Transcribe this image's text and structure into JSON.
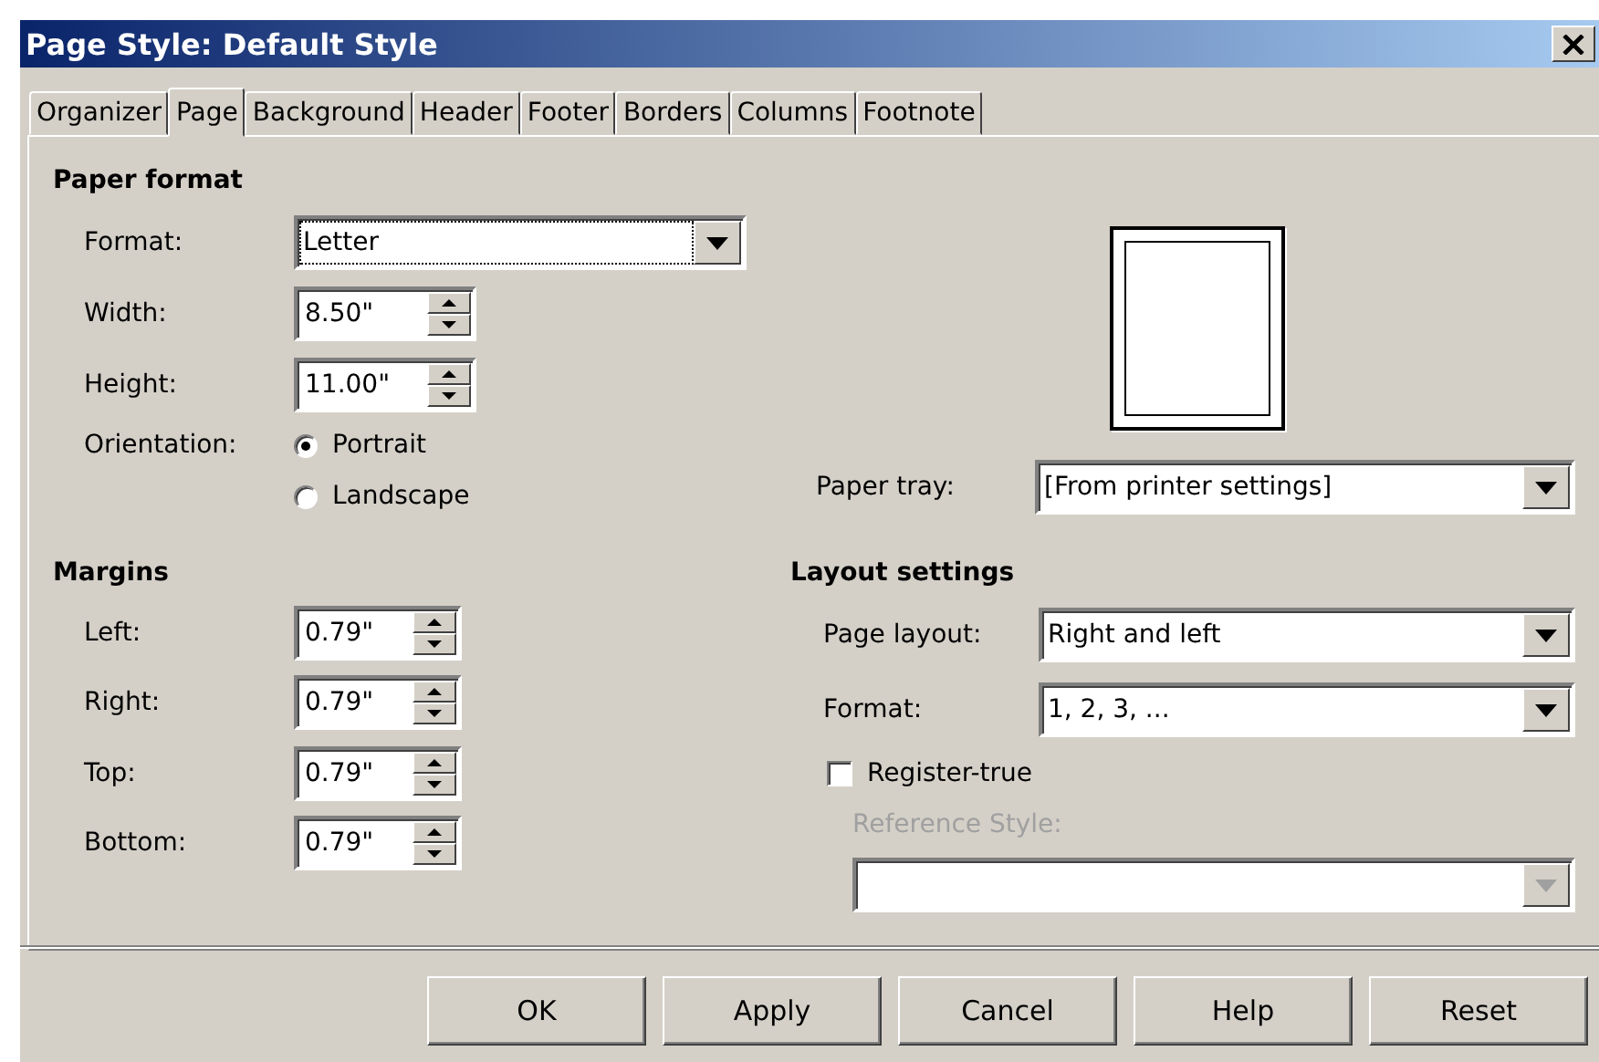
{
  "window": {
    "title": "Page Style: Default Style"
  },
  "tabs": [
    {
      "label": "Organizer",
      "selected": false
    },
    {
      "label": "Page",
      "selected": true
    },
    {
      "label": "Background",
      "selected": false
    },
    {
      "label": "Header",
      "selected": false
    },
    {
      "label": "Footer",
      "selected": false
    },
    {
      "label": "Borders",
      "selected": false
    },
    {
      "label": "Columns",
      "selected": false
    },
    {
      "label": "Footnote",
      "selected": false
    }
  ],
  "paper_format": {
    "heading": "Paper format",
    "format": {
      "label": "Format:",
      "value": "Letter"
    },
    "width": {
      "label": "Width:",
      "value": "8.50\""
    },
    "height": {
      "label": "Height:",
      "value": "11.00\""
    },
    "orientation": {
      "label": "Orientation:",
      "options": [
        {
          "label": "Portrait",
          "selected": true
        },
        {
          "label": "Landscape",
          "selected": false
        }
      ]
    }
  },
  "paper_tray": {
    "label": "Paper tray:",
    "value": "[From printer settings]"
  },
  "margins": {
    "heading": "Margins",
    "fields": [
      {
        "label": "Left:",
        "value": "0.79\""
      },
      {
        "label": "Right:",
        "value": "0.79\""
      },
      {
        "label": "Top:",
        "value": "0.79\""
      },
      {
        "label": "Bottom:",
        "value": "0.79\""
      }
    ]
  },
  "layout_settings": {
    "heading": "Layout settings",
    "page_layout": {
      "label": "Page layout:",
      "value": "Right and left"
    },
    "format": {
      "label": "Format:",
      "value": "1, 2, 3, ..."
    },
    "register_true": {
      "label": "Register-true",
      "checked": false
    },
    "reference_style": {
      "label": "Reference Style:",
      "disabled": true
    }
  },
  "buttons": [
    "OK",
    "Apply",
    "Cancel",
    "Help",
    "Reset"
  ]
}
